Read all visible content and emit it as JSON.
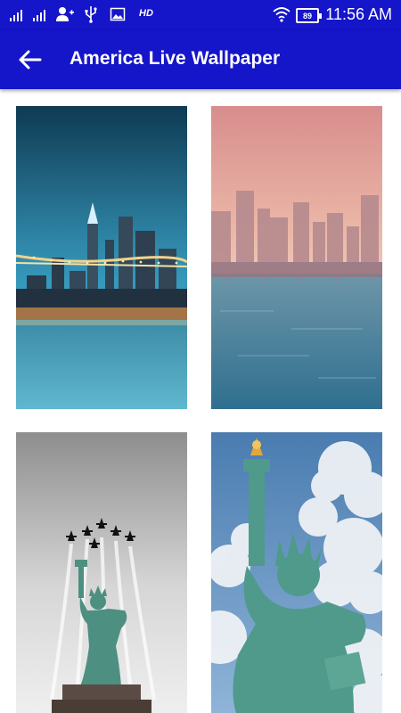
{
  "status_bar": {
    "hd_label": "HD",
    "battery_level": "89",
    "time": "11:56 AM",
    "icons": [
      "signal-icon",
      "signal-icon",
      "add-user-icon",
      "usb-icon",
      "image-icon",
      "wifi-icon",
      "battery-icon"
    ]
  },
  "app_bar": {
    "title": "America Live Wallpaper",
    "back_icon": "arrow-left-icon"
  },
  "wallpapers": [
    {
      "scene": "city-bridge-night"
    },
    {
      "scene": "city-skyline-pink-sky"
    },
    {
      "scene": "statue-of-liberty-jets"
    },
    {
      "scene": "statue-of-liberty-clouds"
    }
  ],
  "colors": {
    "primary": "#1515c9",
    "status_bar": "#1515c9"
  }
}
